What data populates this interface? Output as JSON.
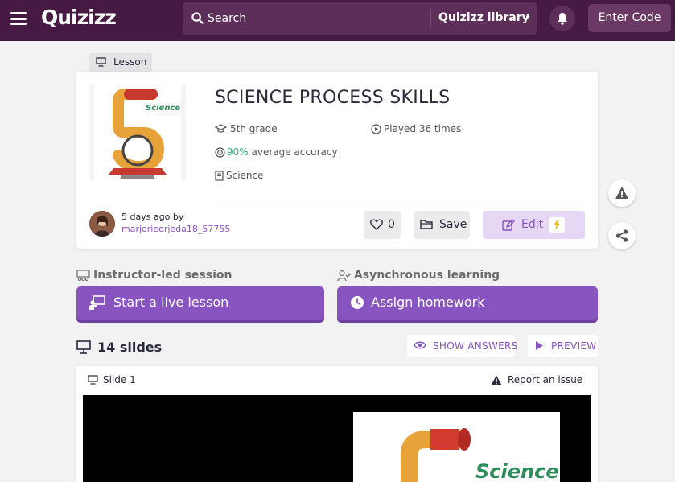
{
  "topbar": {
    "logo": "Quizizz",
    "search_placeholder": "Search",
    "library_label": "Quizizz library",
    "enter_code_label": "Enter Code"
  },
  "lesson_tag": "Lesson",
  "quiz": {
    "title": "SCIENCE PROCESS SKILLS",
    "grade": "5th grade",
    "played": "Played 36 times",
    "accuracy_value": "90%",
    "accuracy_suffix": " average accuracy",
    "subject": "Science",
    "thumb_text": "Science"
  },
  "author": {
    "when": "5 days ago by",
    "name": "marjorieorjeda18_57755"
  },
  "actions": {
    "like_count": "0",
    "save_label": "Save",
    "edit_label": "Edit"
  },
  "modes": {
    "instructor_label": "Instructor-led session",
    "instructor_button": "Start a live lesson",
    "async_label": "Asynchronous learning",
    "async_button": "Assign homework"
  },
  "slides": {
    "count_label": "14 slides",
    "show_answers": "SHOW ANSWERS",
    "preview": "PREVIEW",
    "slide1_label": "Slide 1",
    "report_issue": "Report an issue",
    "slide1_image_text": "Science"
  },
  "colors": {
    "topbar": "#461a42",
    "brand_purple": "#8854c0",
    "accuracy_green": "#2bb775"
  }
}
